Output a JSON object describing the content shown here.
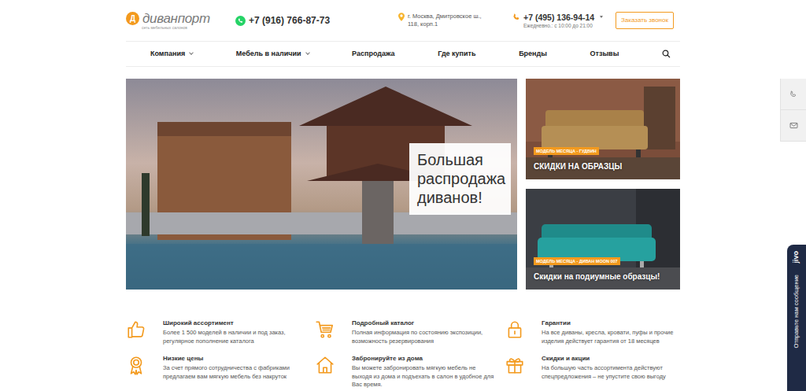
{
  "header": {
    "logo": {
      "mark": "Д",
      "name": "диванпорт",
      "tagline": "сеть мебельных салонов"
    },
    "whatsapp_phone": "+7 (916) 766-87-73",
    "address": "г. Москва, Дмитровское ш., 118, корп.1",
    "phone": {
      "number": "+7 (495) 136-94-14",
      "hours": "Ежедневно.: с 10:00 до 21:00"
    },
    "callback_button": "Заказать звонок"
  },
  "nav": [
    {
      "label": "Компания",
      "kind": "dropdown"
    },
    {
      "label": "Мебель в наличии",
      "kind": "dropdown"
    },
    {
      "label": "Распродажа",
      "kind": "link"
    },
    {
      "label": "Где купить",
      "kind": "link"
    },
    {
      "label": "Бренды",
      "kind": "link"
    },
    {
      "label": "Отзывы",
      "kind": "link"
    }
  ],
  "hero": {
    "banner_title": "Большая распродажа диванов!",
    "cards": [
      {
        "label": "МОДЕЛЬ МЕСЯЦА - ГУДВИН",
        "title": "СКИДКИ НА ОБРАЗЦЫ"
      },
      {
        "label": "МОДЕЛЬ МЕСЯЦА - ДИВАН MOON 007",
        "title": "Скидки на подиумные образцы!"
      }
    ]
  },
  "features": [
    {
      "title": "Широкий ассортимент",
      "text": "Более 1 500 моделей в наличии и под заказ, регулярное пополнение каталога"
    },
    {
      "title": "Подробный каталог",
      "text": "Полная информация по состоянию экспозиции, возможность резервирования"
    },
    {
      "title": "Гарантии",
      "text": "На все диваны, кресла, кровати, пуфы и прочие изделия действует гарантия от 18 месяцев"
    },
    {
      "title": "Низкие цены",
      "text": "За счет прямого сотрудничества с фабриками предлагаем вам мягкую мебель без накруток"
    },
    {
      "title": "Забронируйте из дома",
      "text": "Вы можете забронировать мягкую мебель не выходя из дома и подъехать в салон в удобное для Вас время."
    },
    {
      "title": "Скидки и акции",
      "text": "На большую часть ассортимента действуют спецпредложения – не упустите свою выгоду"
    }
  ],
  "side_widget": {
    "brand": "jivo",
    "message": "Отправьте нам сообщение"
  }
}
